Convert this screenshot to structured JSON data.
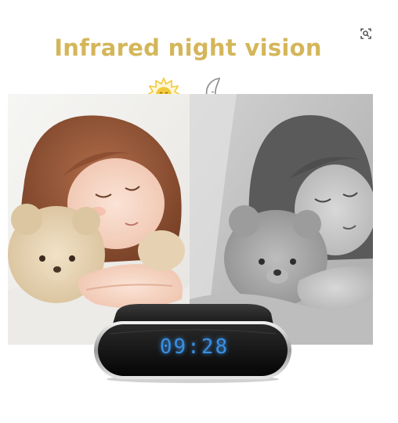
{
  "headline": "Infrared night vision",
  "clock_display": "09:28",
  "colors": {
    "headline": "#d4b65a",
    "clock_digits": "#3a8fe0",
    "sun": "#f2c93a",
    "moon_outline": "#8a8a8a"
  },
  "icons": {
    "lens_button": "image-search-icon",
    "day": "sun-icon",
    "night": "moon-icon"
  },
  "panels": {
    "left": "color-daylight-photo",
    "right": "grayscale-infrared-photo"
  }
}
